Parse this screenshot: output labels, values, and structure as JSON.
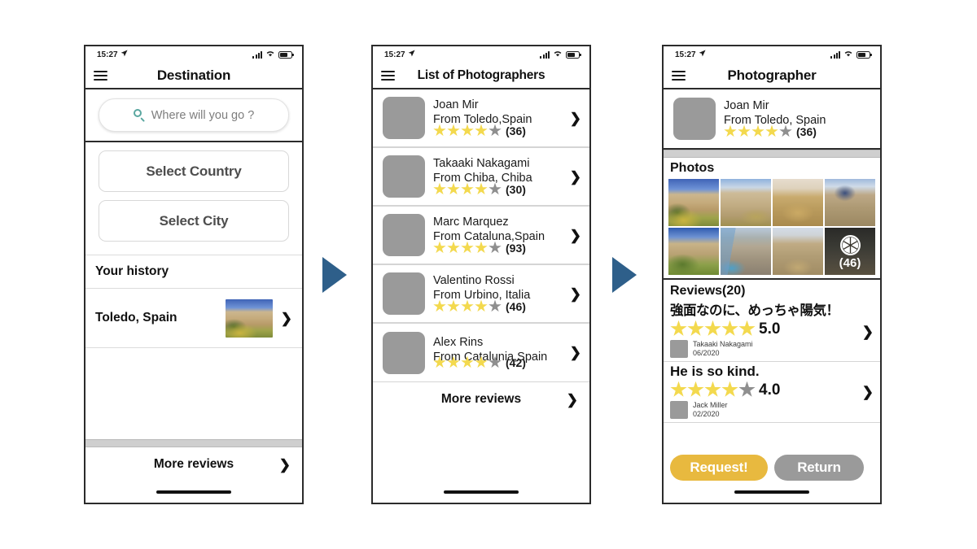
{
  "meta": {
    "status_time": "15:27",
    "location_arrow": "➢"
  },
  "colors": {
    "accent_yellow": "#E8B93F",
    "star_on": "#F3D94E",
    "star_off": "#8F8F8F",
    "arrow_blue": "#2E5F8A",
    "avatar_gray": "#9A9A9A",
    "search_icon_teal": "#5AA7A0"
  },
  "screen1": {
    "nav_title": "Destination",
    "search": {
      "placeholder": "Where will you go ?",
      "icon": "search-icon"
    },
    "select_country_label": "Select Country",
    "select_city_label": "Select City",
    "history_header": "Your history",
    "history_item": {
      "label": "Toledo, Spain",
      "chevron": "❯"
    },
    "more_reviews_label": "More reviews",
    "more_reviews_chevron": "❯"
  },
  "screen2": {
    "nav_title": "List of Photographers",
    "photographers": [
      {
        "name": "Joan Mir",
        "from": "From Toledo,Spain",
        "stars_on": 4,
        "stars_total": 5,
        "count": "(36)"
      },
      {
        "name": "Takaaki Nakagami",
        "from": "From Chiba, Chiba",
        "stars_on": 4,
        "stars_total": 5,
        "count": "(30)"
      },
      {
        "name": "Marc Marquez",
        "from": "From Cataluna,Spain",
        "stars_on": 4,
        "stars_total": 5,
        "count": "(93)"
      },
      {
        "name": "Valentino Rossi",
        "from": "From Urbino, Italia",
        "stars_on": 4,
        "stars_total": 5,
        "count": "(46)"
      },
      {
        "name": "Alex Rins",
        "from": "From Catalunia,Spain",
        "stars_on": 4,
        "stars_total": 5,
        "count": "(42)"
      }
    ],
    "more_reviews_label": "More reviews",
    "more_reviews_chevron": "❯",
    "row_chevron": "❯"
  },
  "screen3": {
    "nav_title": "Photographer",
    "profile": {
      "name": "Joan Mir",
      "from": "From Toledo, Spain",
      "stars_on": 4,
      "stars_total": 5,
      "count": "(36)"
    },
    "photos_header": "Photos",
    "photos_more_count": "(46)",
    "photos_more_icon": "aperture-icon",
    "reviews_header": "Reviews(20)",
    "reviews": [
      {
        "title": "強面なのに、めっちゃ陽気！",
        "stars_on": 5,
        "stars_total": 5,
        "score": "5.0",
        "author": "Takaaki Nakagami",
        "date": "06/2020",
        "chevron": "❯"
      },
      {
        "title": "He is so kind.",
        "stars_on": 4,
        "stars_total": 5,
        "score": "4.0",
        "author": "Jack Miller",
        "date": "02/2020",
        "chevron": "❯"
      }
    ],
    "request_button": "Request!",
    "return_button": "Return"
  },
  "flow": {
    "arrow1": "flow-arrow",
    "arrow2": "flow-arrow"
  }
}
